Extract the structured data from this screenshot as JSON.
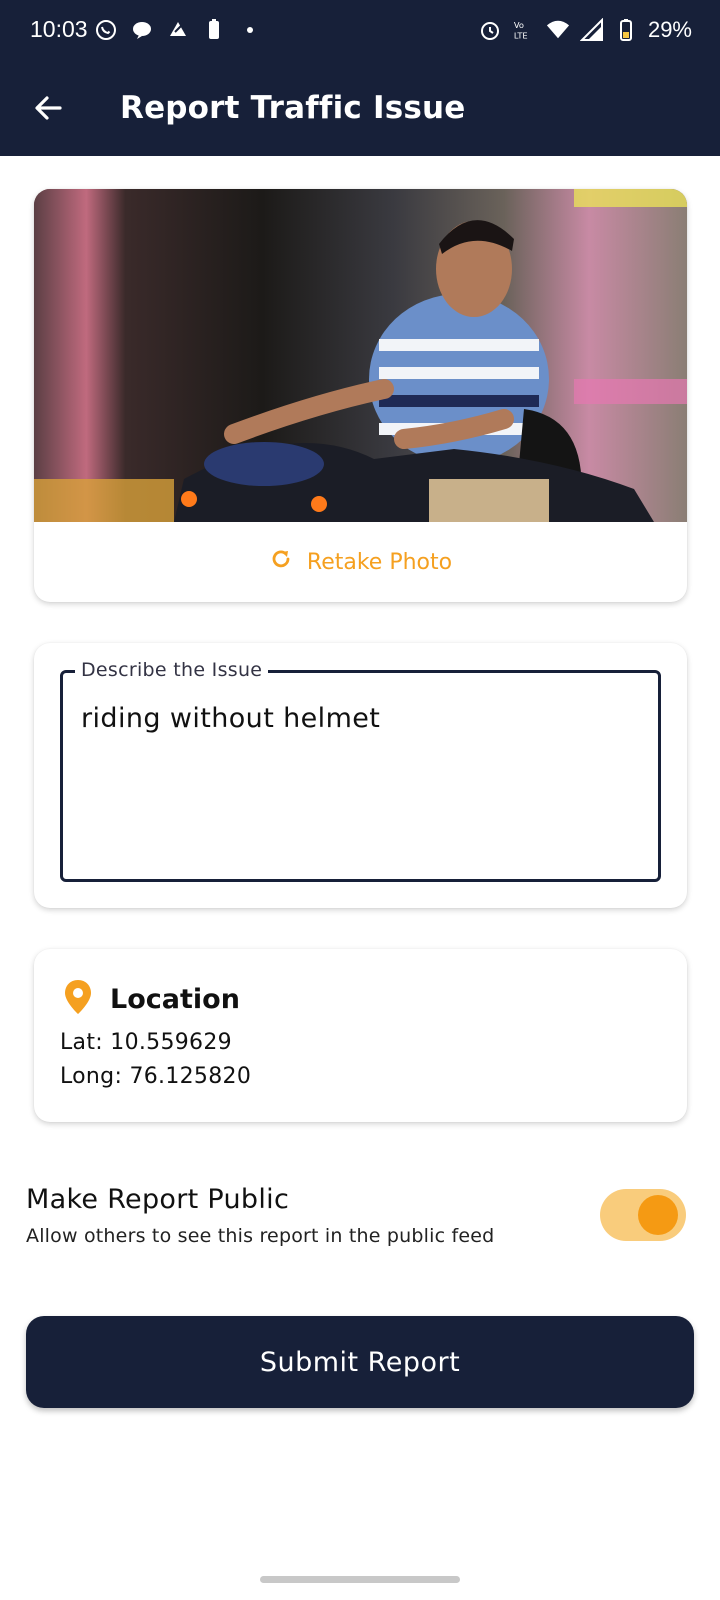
{
  "status_bar": {
    "time": "10:03",
    "battery_percent": "29%",
    "icons_left": [
      "whatsapp-icon",
      "chat-icon",
      "app-icon",
      "battery-small-icon",
      "dot-icon"
    ],
    "icons_right": [
      "alarm-icon",
      "volte-icon",
      "wifi-icon",
      "signal-icon",
      "battery-icon"
    ]
  },
  "app_bar": {
    "title": "Report Traffic Issue",
    "back_icon": "arrow-left-icon"
  },
  "photo_card": {
    "retake_label": "Retake Photo",
    "retake_icon": "refresh-icon"
  },
  "description": {
    "label": "Describe the Issue",
    "value": "riding without helmet"
  },
  "location": {
    "title": "Location",
    "icon": "location-pin-icon",
    "lat": "Lat: 10.559629",
    "long": "Long: 76.125820"
  },
  "public_toggle": {
    "title": "Make Report Public",
    "subtitle": "Allow others to see this report in the public feed",
    "enabled": true
  },
  "submit": {
    "label": "Submit Report"
  },
  "colors": {
    "primary": "#172039",
    "accent": "#f59a13",
    "accent_light": "#f9cc7c"
  }
}
